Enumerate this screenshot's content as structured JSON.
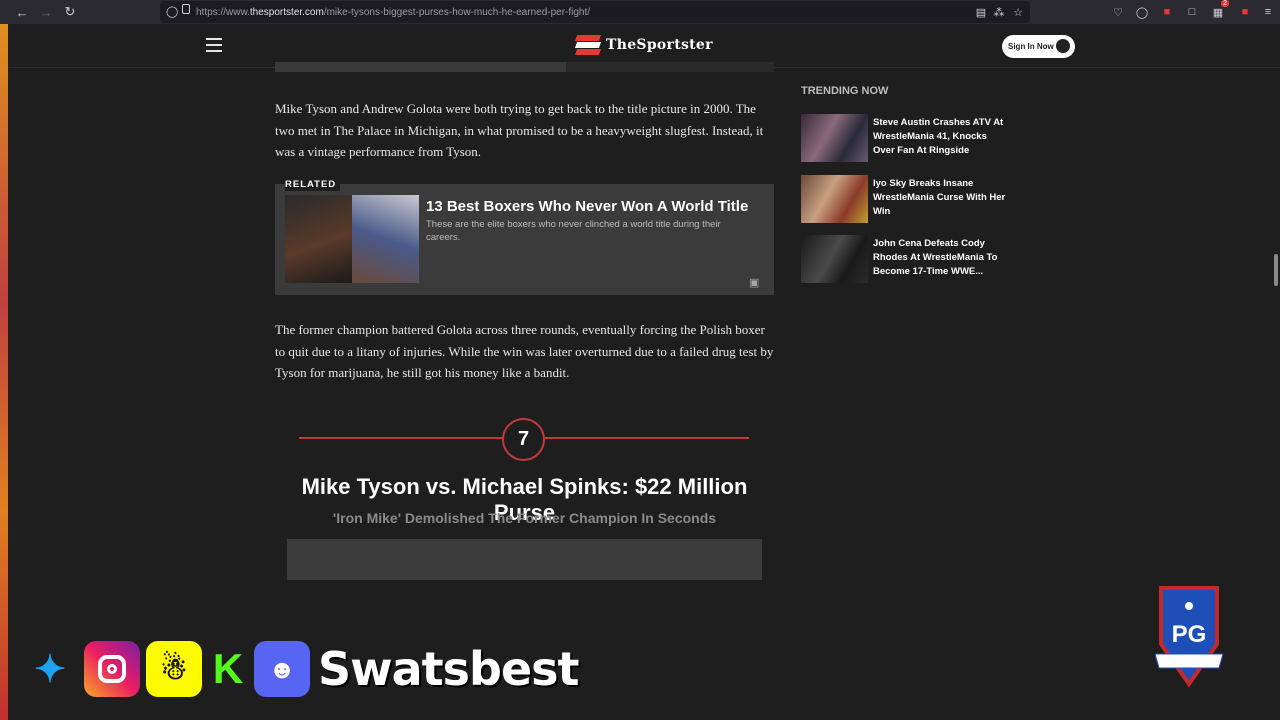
{
  "browser": {
    "url_prefix": "https://www.",
    "url_domain": "thesportster.com",
    "url_path": "/mike-tysons-biggest-purses-how-much-he-earned-per-fight/",
    "notification_count": "2"
  },
  "header": {
    "site_name": "TheSportster",
    "sign_in_label": "Sign In Now"
  },
  "article": {
    "paragraph1": "Mike Tyson and Andrew Golota were both trying to get back to the title picture in 2000. The two met in The Palace in Michigan, in what promised to be a heavyweight slugfest. Instead, it was a vintage performance from Tyson.",
    "related": {
      "tag": "RELATED",
      "title": "13 Best Boxers Who Never Won A World Title",
      "description": "These are the elite boxers who never clinched a world title during their careers."
    },
    "paragraph2": "The former champion battered Golota across three rounds, eventually forcing the Polish boxer to quit due to a litany of injuries. While the win was later overturned due to a failed drug test by Tyson for marijuana, he still got his money like a bandit.",
    "section": {
      "number": "7",
      "title": "Mike Tyson vs. Michael Spinks: $22 Million Purse",
      "subtitle": "'Iron Mike' Demolished The Former Champion In Seconds"
    }
  },
  "sidebar": {
    "heading": "TRENDING NOW",
    "items": [
      {
        "title": "Steve Austin Crashes ATV At WrestleMania 41, Knocks Over Fan At Ringside"
      },
      {
        "title": "Iyo Sky Breaks Insane WrestleMania Curse With Her Win"
      },
      {
        "title": "John Cena Defeats Cody Rhodes At WrestleMania To Become 17-Time WWE..."
      }
    ]
  },
  "overlay": {
    "handle": "Swatsbest",
    "badge_text": "PG"
  }
}
